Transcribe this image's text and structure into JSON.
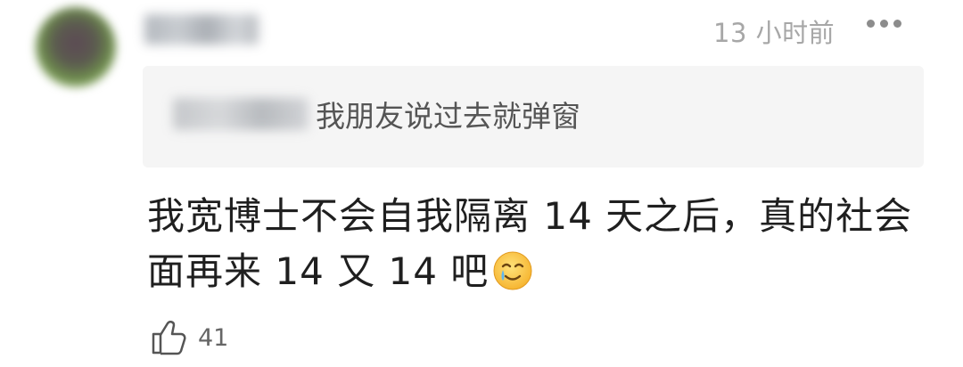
{
  "comment": {
    "time": "13 小时前",
    "quote_text": "我朋友说过去就弹窗",
    "body_line1": "我宽博士不会自我隔离 14 天之后，真的社会",
    "body_line2": "面再来 14 又 14 吧",
    "emoji": "crying-smile-emoji",
    "like_count": "41"
  },
  "icons": {
    "more": "more-dots-icon",
    "like": "thumbs-up-icon"
  }
}
